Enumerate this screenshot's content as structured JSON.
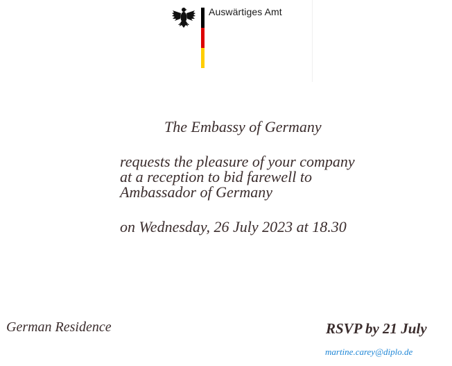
{
  "letterhead": {
    "org_name": "Auswärtiges Amt",
    "emblem_icon": "federal-eagle-icon",
    "flag_colors": [
      "#000000",
      "#dd0000",
      "#ffce00"
    ]
  },
  "invitation": {
    "host": "The Embassy of Germany",
    "body_lines": [
      "requests the pleasure of your company",
      "at a reception to bid farewell to",
      "Ambassador of Germany"
    ],
    "datetime": "on Wednesday, 26 July 2023 at 18.30"
  },
  "footer": {
    "venue": "German Residence",
    "rsvp": "RSVP by 21 July",
    "email": "martine.carey@diplo.de"
  },
  "colors": {
    "text": "#3b2d2d",
    "link": "#1f86d6"
  }
}
